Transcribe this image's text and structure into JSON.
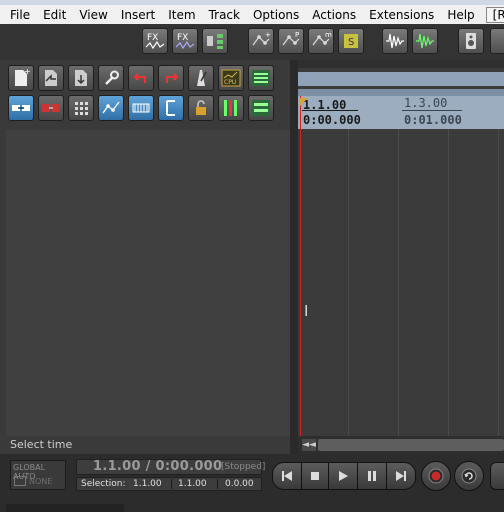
{
  "menu": {
    "items": [
      "File",
      "Edit",
      "View",
      "Insert",
      "Item",
      "Track",
      "Options",
      "Actions",
      "Extensions",
      "Help",
      "[Remov"
    ]
  },
  "toolbar_top": {
    "icons": [
      "fx-chain-icon",
      "fx-chain-alt-icon",
      "routing-icon",
      "envelope-add-icon",
      "envelope-p-icon",
      "envelope-m-icon",
      "solo-icon",
      "waveform-icon",
      "waveform-green-icon",
      "speaker-icon"
    ]
  },
  "toolbar_left_row1": {
    "icons": [
      "new-project-icon",
      "open-project-icon",
      "save-project-icon",
      "wrench-icon",
      "undo-icon",
      "redo-icon",
      "metronome-icon",
      "cpu-meter-icon",
      "mixer-icon"
    ]
  },
  "toolbar_left_row2": {
    "icons": [
      "ripple-edit-icon",
      "snap-icon",
      "grid-icon",
      "envelope-link-icon",
      "locking-icon",
      "item-grouping-icon",
      "lock-icon",
      "track-meter-icon",
      "track-height-icon"
    ],
    "cpu_label": "CPU"
  },
  "timeline": {
    "marker_primary": "1.1.00",
    "marker_primary_time": "0:00.000",
    "marker_secondary": "1.3.00",
    "marker_secondary_time": "0:01.000"
  },
  "status": {
    "action_text": "Select time"
  },
  "transport": {
    "global_auto_label": "GLOBAL AUTO",
    "global_auto_value": "NONE",
    "position": "1.1.00 / 0:00.000",
    "state": "[Stopped]",
    "selection_label": "Selection:",
    "selection_start": "1.1.00",
    "selection_end": "1.1.00",
    "selection_length": "0.0.00",
    "buttons": [
      "go-to-start-icon",
      "stop-icon",
      "play-icon",
      "pause-icon",
      "go-to-end-icon",
      "record-icon",
      "repeat-icon"
    ]
  },
  "colors": {
    "record_red": "#c82a2a",
    "cursor": "#d02020",
    "ruler": "#9cadc0"
  }
}
